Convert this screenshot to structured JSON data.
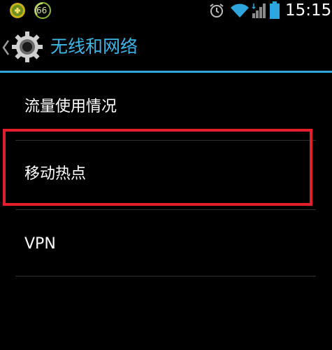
{
  "status_bar": {
    "time": "15:15",
    "notification_badge": "66",
    "icons": [
      "app-notification-icon",
      "speed-badge-icon",
      "alarm-icon",
      "wifi-icon",
      "signal-icon",
      "battery-icon"
    ]
  },
  "header": {
    "title": "无线和网络",
    "icon": "gear-icon",
    "back_icon": "chevron-left-icon"
  },
  "list": {
    "items": [
      {
        "label": "流量使用情况"
      },
      {
        "label": "移动热点"
      },
      {
        "label": "VPN"
      }
    ]
  },
  "colors": {
    "accent": "#3db6e8",
    "highlight": "#e41e2b",
    "background": "#000000"
  }
}
